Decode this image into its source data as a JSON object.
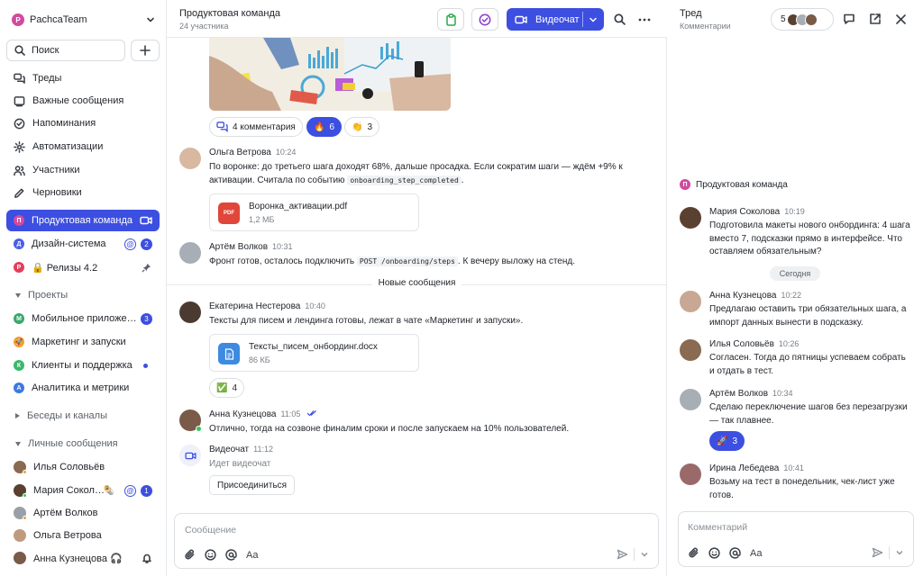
{
  "workspace": {
    "name": "PachcaTeam",
    "initial": "P"
  },
  "sidebar": {
    "search_label": "Поиск",
    "nav": [
      {
        "label": "Треды",
        "icon": "threads-icon"
      },
      {
        "label": "Важные сообщения",
        "icon": "bookmark-icon"
      },
      {
        "label": "Напоминания",
        "icon": "reminder-icon"
      },
      {
        "label": "Автоматизации",
        "icon": "gear-icon"
      },
      {
        "label": "Участники",
        "icon": "people-icon"
      },
      {
        "label": "Черновики",
        "icon": "pencil-icon"
      }
    ],
    "channels": [
      {
        "label": "Продуктовая команда",
        "initial": "П",
        "color": "#d24aa0",
        "active": true
      },
      {
        "label": "Дизайн-система",
        "initial": "Д",
        "color": "#4a5de8",
        "mention": "@",
        "badge": "2"
      },
      {
        "label": "🔒 Релизы 4.2",
        "initial": "Р",
        "color": "#e0405a"
      }
    ],
    "projects_header": "Проекты",
    "projects": [
      {
        "label": "Мобильное приложе…",
        "initial": "М",
        "color": "#3aa86b",
        "badge": "3"
      },
      {
        "label": "Маркетинг и запуски",
        "initial": "🚀",
        "color": "#f0a030"
      },
      {
        "label": "Клиенты и поддержка",
        "initial": "К",
        "color": "#3ab86b"
      },
      {
        "label": "Аналитика и метрики",
        "initial": "А",
        "color": "#3d7ae0"
      }
    ],
    "groups_header": "Беседы и каналы",
    "dms_header": "Личные сообщения",
    "dms": [
      {
        "label": "Илья Соловьёв",
        "color": "#8a6a50",
        "status": "#f0a030"
      },
      {
        "label": "Мария Сокол…",
        "color": "#5a4030",
        "status": "#34c759",
        "emoji": "🌯",
        "mention": "@",
        "badge": "1"
      },
      {
        "label": "Артём Волков",
        "color": "#9aa0a8",
        "status": "#f0a030"
      },
      {
        "label": "Ольга Ветрова",
        "color": "#c09a80",
        "status": ""
      },
      {
        "label": "Анна Кузнецова 🎧",
        "color": "#7a5a48",
        "status": ""
      }
    ]
  },
  "chat": {
    "title": "Продуктовая команда",
    "subtitle": "24 участника",
    "video_label": "Видеочат",
    "reactions_top": {
      "comments": "4 комментария",
      "fire": "🔥",
      "fire_count": "6",
      "clap": "👏",
      "clap_count": "3"
    },
    "messages": {
      "olga": {
        "author": "Ольга Ветрова",
        "time": "10:24",
        "text_a": "По воронке: до третьего шага доходят 68%, дальше просадка. Если сократим шаги — ждём +9% к активации. Считала по событию ",
        "code": "onboarding_step_completed",
        "text_b": ".",
        "file_name": "Воронка_активации.pdf",
        "file_size": "1,2 МБ",
        "file_type": "PDF"
      },
      "artem": {
        "author": "Артём Волков",
        "time": "10:31",
        "text_a": "Фронт готов, осталось подключить ",
        "code": "POST /onboarding/steps",
        "text_b": ". К вечеру выложу на стенд."
      },
      "divider": "Новые сообщения",
      "ekaterina": {
        "author": "Екатерина Нестерова",
        "time": "10:40",
        "text": "Тексты для писем и лендинга готовы, лежат в чате «Маркетинг и запуски».",
        "file_name": "Тексты_писем_онбординг.docx",
        "file_size": "86 КБ",
        "reaction": "✅",
        "reaction_count": "4"
      },
      "anna": {
        "author": "Анна Кузнецова",
        "time": "11:05",
        "text": "Отлично, тогда на созвоне финалим сроки и после запускаем на 10% пользователей."
      },
      "video": {
        "author": "Видеочат",
        "time": "11:12",
        "text": "Идет видеочат",
        "join": "Присоединиться"
      }
    },
    "composer_placeholder": "Сообщение",
    "format_label": "Aa"
  },
  "thread": {
    "title": "Тред",
    "subtitle": "Комментарии",
    "participants_count": "5",
    "channel": "Продуктовая команда",
    "channel_initial": "П",
    "today_label": "Сегодня",
    "messages": [
      {
        "author": "Мария Соколова",
        "time": "10:19",
        "text": "Подготовила макеты нового онбординга: 4 шага вместо 7, подсказки прямо в интерфейсе. Что оставляем обязательным?"
      },
      {
        "author": "Анна Кузнецова",
        "time": "10:22",
        "text": "Предлагаю оставить три обязательных шага, а импорт данных вынести в подсказку."
      },
      {
        "author": "Илья Соловьёв",
        "time": "10:26",
        "text": "Согласен. Тогда до пятницы успеваем собрать и отдать в тест."
      },
      {
        "author": "Артём Волков",
        "time": "10:34",
        "text": "Сделаю переключение шагов без перезагрузки — так плавнее.",
        "reaction": "🚀",
        "reaction_count": "3"
      },
      {
        "author": "Ирина Лебедева",
        "time": "10:41",
        "text": "Возьму на тест в понедельник, чек-лист уже готов."
      }
    ],
    "composer_placeholder": "Комментарий",
    "format_label": "Aa"
  },
  "colors": {
    "accent": "#3d4fe0",
    "online": "#34c759"
  }
}
